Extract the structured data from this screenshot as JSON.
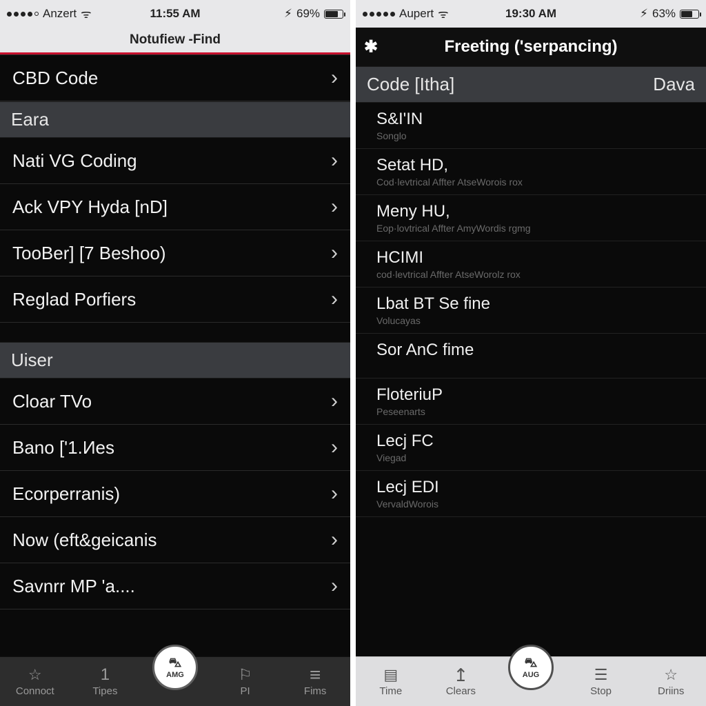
{
  "left": {
    "status": {
      "carrier": "Anzert",
      "time": "11:55 AM",
      "battery_pct": "69%",
      "battery_fill": 69
    },
    "title": "Notufiew -Find",
    "sections": [
      {
        "header": null,
        "rows": [
          {
            "label": "CBD Code"
          }
        ]
      },
      {
        "header": "Eara",
        "rows": [
          {
            "label": "Nati VG Coding"
          },
          {
            "label": "Ack VPY Hyda [nD]"
          },
          {
            "label": "TooBer] [7 Beshoo)"
          },
          {
            "label": "Reglad Porfiers"
          }
        ]
      },
      {
        "header": "Uiser",
        "rows": [
          {
            "label": "Cloar TVo"
          },
          {
            "label": "Bano ['1.Иes"
          },
          {
            "label": "Ecorperranis)"
          },
          {
            "label": "Now (eft&geicanis"
          },
          {
            "label": "Savnrr MP 'a...."
          }
        ]
      }
    ],
    "tabs": [
      {
        "label": "Connoct",
        "icon": "star-outline"
      },
      {
        "label": "Tipes",
        "icon": "one-glyph"
      },
      {
        "label": "AMG",
        "icon": "center"
      },
      {
        "label": "PI",
        "icon": "flag-outline"
      },
      {
        "label": "Fims",
        "icon": "burger"
      }
    ],
    "center_button": "AMG"
  },
  "right": {
    "status": {
      "carrier": "Aupert",
      "time": "19:30 AM",
      "battery_pct": "63%",
      "battery_fill": 63
    },
    "title": "Freeting ('serpancing)",
    "list_header_left": "Code [Itha]",
    "list_header_right": "Dava",
    "rows": [
      {
        "title": "S&I'IN",
        "sub": "Songlo"
      },
      {
        "title": "Setat HD,",
        "sub": "Cod·levtrical Affter AtseWorois rox"
      },
      {
        "title": "Meny HU,",
        "sub": "Eop·lovtrical Affter AmyWordis rgmg"
      },
      {
        "title": "HCIMI",
        "sub": "cod·levtrical Affter AtseWorolz rox"
      },
      {
        "title": "Lbat BT Se fine",
        "sub": "Volucayas"
      },
      {
        "title": "Sor AnC fime",
        "sub": ""
      },
      {
        "title": "FloteriuP",
        "sub": "Peseenarts"
      },
      {
        "title": "Lecj FC",
        "sub": "Viegad"
      },
      {
        "title": "Lecj EDI",
        "sub": "VervaldWorois"
      }
    ],
    "tabs": [
      {
        "label": "Time",
        "icon": "doc"
      },
      {
        "label": "Clears",
        "icon": "uparrow"
      },
      {
        "label": "AUG",
        "icon": "center"
      },
      {
        "label": "Stop",
        "icon": "listlines",
        "active": true
      },
      {
        "label": "Driins",
        "icon": "star-outline"
      }
    ],
    "center_button": "AUG"
  }
}
